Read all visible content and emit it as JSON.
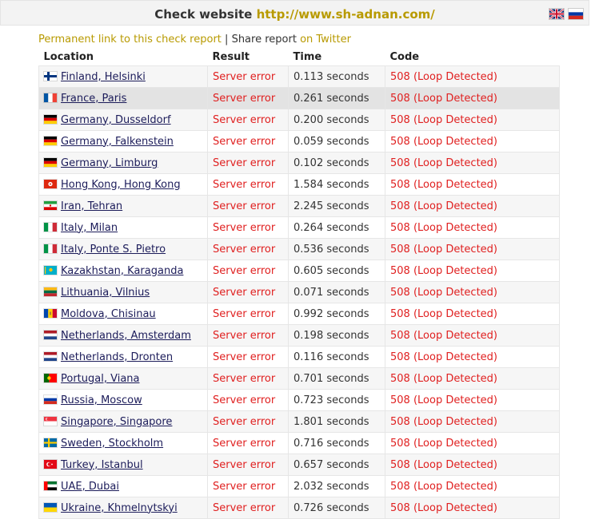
{
  "header": {
    "title_prefix": "Check website",
    "url": "http://www.sh-adnan.com/"
  },
  "links": {
    "permalink": "Permanent link to this check report",
    "separator": "|",
    "share": "Share report",
    "twitter": "on Twitter"
  },
  "columns": [
    "Location",
    "Result",
    "Time",
    "Code"
  ],
  "rows": [
    {
      "location": "Finland, Helsinki",
      "flag": "fi",
      "result": "Server error",
      "time": "0.113 seconds",
      "code": "508 (Loop Detected)"
    },
    {
      "location": "France, Paris",
      "flag": "fr",
      "result": "Server error",
      "time": "0.261 seconds",
      "code": "508 (Loop Detected)"
    },
    {
      "location": "Germany, Dusseldorf",
      "flag": "de",
      "result": "Server error",
      "time": "0.200 seconds",
      "code": "508 (Loop Detected)"
    },
    {
      "location": "Germany, Falkenstein",
      "flag": "de",
      "result": "Server error",
      "time": "0.059 seconds",
      "code": "508 (Loop Detected)"
    },
    {
      "location": "Germany, Limburg",
      "flag": "de",
      "result": "Server error",
      "time": "0.102 seconds",
      "code": "508 (Loop Detected)"
    },
    {
      "location": "Hong Kong, Hong Kong",
      "flag": "hk",
      "result": "Server error",
      "time": "1.584 seconds",
      "code": "508 (Loop Detected)"
    },
    {
      "location": "Iran, Tehran",
      "flag": "ir",
      "result": "Server error",
      "time": "2.245 seconds",
      "code": "508 (Loop Detected)"
    },
    {
      "location": "Italy, Milan",
      "flag": "it",
      "result": "Server error",
      "time": "0.264 seconds",
      "code": "508 (Loop Detected)"
    },
    {
      "location": "Italy, Ponte S. Pietro",
      "flag": "it",
      "result": "Server error",
      "time": "0.536 seconds",
      "code": "508 (Loop Detected)"
    },
    {
      "location": "Kazakhstan, Karaganda",
      "flag": "kz",
      "result": "Server error",
      "time": "0.605 seconds",
      "code": "508 (Loop Detected)"
    },
    {
      "location": "Lithuania, Vilnius",
      "flag": "lt",
      "result": "Server error",
      "time": "0.071 seconds",
      "code": "508 (Loop Detected)"
    },
    {
      "location": "Moldova, Chisinau",
      "flag": "md",
      "result": "Server error",
      "time": "0.992 seconds",
      "code": "508 (Loop Detected)"
    },
    {
      "location": "Netherlands, Amsterdam",
      "flag": "nl",
      "result": "Server error",
      "time": "0.198 seconds",
      "code": "508 (Loop Detected)"
    },
    {
      "location": "Netherlands, Dronten",
      "flag": "nl",
      "result": "Server error",
      "time": "0.116 seconds",
      "code": "508 (Loop Detected)"
    },
    {
      "location": "Portugal, Viana",
      "flag": "pt",
      "result": "Server error",
      "time": "0.701 seconds",
      "code": "508 (Loop Detected)"
    },
    {
      "location": "Russia, Moscow",
      "flag": "ru",
      "result": "Server error",
      "time": "0.723 seconds",
      "code": "508 (Loop Detected)"
    },
    {
      "location": "Singapore, Singapore",
      "flag": "sg",
      "result": "Server error",
      "time": "1.801 seconds",
      "code": "508 (Loop Detected)"
    },
    {
      "location": "Sweden, Stockholm",
      "flag": "se",
      "result": "Server error",
      "time": "0.716 seconds",
      "code": "508 (Loop Detected)"
    },
    {
      "location": "Turkey, Istanbul",
      "flag": "tr",
      "result": "Server error",
      "time": "0.657 seconds",
      "code": "508 (Loop Detected)"
    },
    {
      "location": "UAE, Dubai",
      "flag": "ae",
      "result": "Server error",
      "time": "2.032 seconds",
      "code": "508 (Loop Detected)"
    },
    {
      "location": "Ukraine, Khmelnytskyi",
      "flag": "ua",
      "result": "Server error",
      "time": "0.726 seconds",
      "code": "508 (Loop Detected)"
    }
  ],
  "highlighted_row": 1,
  "colors": {
    "accent": "#b89a00",
    "error": "#e02020",
    "location_link": "#1c1c5a"
  }
}
